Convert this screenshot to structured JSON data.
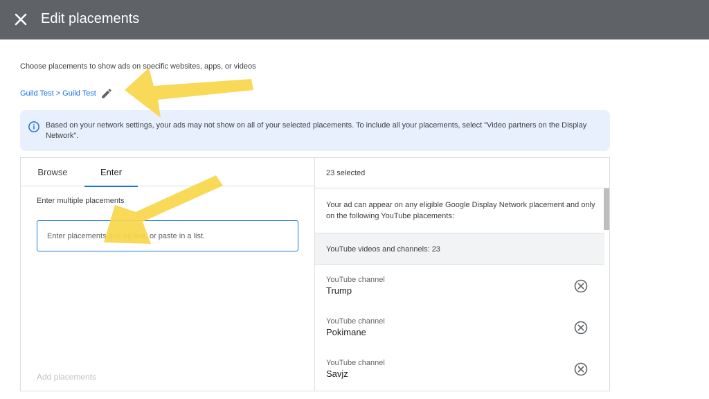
{
  "header": {
    "title": "Edit placements",
    "close_icon": "close-icon"
  },
  "intro": "Choose placements to show ads on specific websites, apps, or videos",
  "breadcrumb": {
    "campaign": "Guild Test",
    "separator": ">",
    "ad_group": "Guild Test",
    "edit_icon": "pencil-icon"
  },
  "info": {
    "icon": "info-icon",
    "text": "Based on your network settings, your ads may not show on all of your selected placements. To include all your placements, select \"Video partners on the Display Network\"."
  },
  "left_panel": {
    "tabs": [
      {
        "label": "Browse",
        "active": false
      },
      {
        "label": "Enter",
        "active": true
      }
    ],
    "enter_label": "Enter multiple placements",
    "input_placeholder": "Enter placements one by line, or paste in a list.",
    "input_value": "",
    "add_button": "Add placements"
  },
  "right_panel": {
    "selected_count": "23 selected",
    "eligible_text": "Your ad can appear on any eligible Google Display Network placement and only on the following YouTube placements:",
    "group_header": "YouTube videos and channels: 23",
    "items": [
      {
        "type": "YouTube channel",
        "name": "Trump"
      },
      {
        "type": "YouTube channel",
        "name": "Pokimane"
      },
      {
        "type": "YouTube channel",
        "name": "Savjz"
      }
    ]
  },
  "colors": {
    "header_bg": "#5f6368",
    "link": "#1a73e8",
    "info_bg": "#e8f0fe",
    "annotation_arrow": "#f9d64a"
  }
}
